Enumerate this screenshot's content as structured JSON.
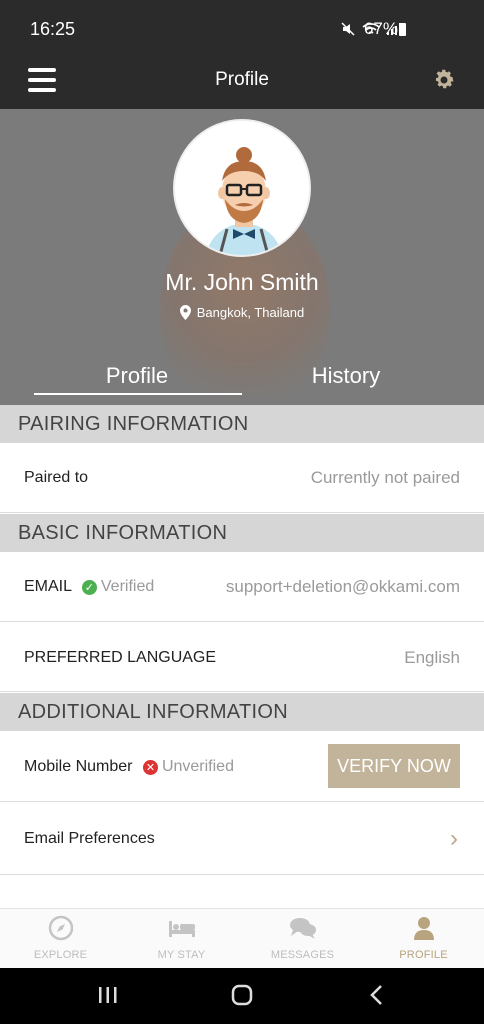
{
  "status_bar": {
    "time": "16:25",
    "battery": "67%"
  },
  "header": {
    "title": "Profile"
  },
  "profile": {
    "name": "Mr. John Smith",
    "location": "Bangkok, Thailand"
  },
  "tabs": [
    {
      "label": "Profile",
      "active": true
    },
    {
      "label": "History",
      "active": false
    }
  ],
  "sections": {
    "pairing": {
      "title": "PAIRING INFORMATION",
      "paired_label": "Paired to",
      "paired_value": "Currently not paired"
    },
    "basic": {
      "title": "BASIC INFORMATION",
      "email_label": "EMAIL",
      "email_status": "Verified",
      "email_value": "support+deletion@okkami.com",
      "language_label": "PREFERRED LANGUAGE",
      "language_value": "English"
    },
    "additional": {
      "title": "ADDITIONAL INFORMATION",
      "mobile_label": "Mobile Number",
      "mobile_status": "Unverified",
      "verify_button": "VERIFY NOW",
      "email_pref_label": "Email Preferences"
    }
  },
  "bottom_nav": [
    {
      "label": "EXPLORE",
      "icon": "compass-icon",
      "active": false
    },
    {
      "label": "MY STAY",
      "icon": "bed-icon",
      "active": false
    },
    {
      "label": "MESSAGES",
      "icon": "chat-icon",
      "active": false
    },
    {
      "label": "PROFILE",
      "icon": "person-icon",
      "active": true
    }
  ],
  "colors": {
    "accent": "#C2B49A",
    "dark_bar": "#2B2B2B",
    "section_bg": "#D6D6D6",
    "verified": "#4CAF50",
    "unverified": "#DD3333"
  }
}
